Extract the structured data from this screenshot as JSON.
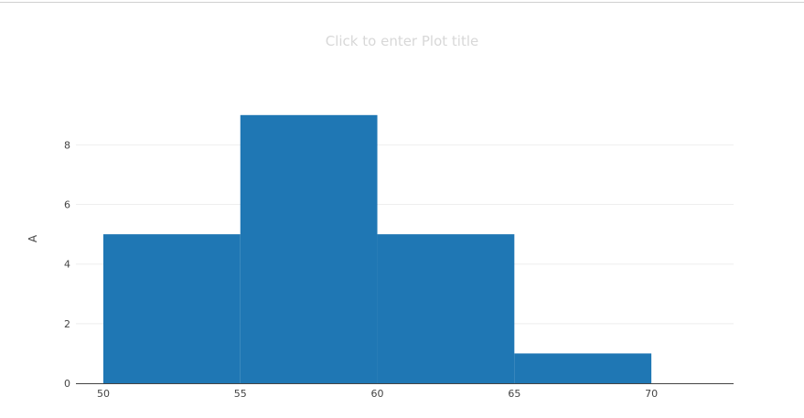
{
  "chart_data": {
    "type": "bar",
    "subtype": "histogram",
    "title": "Click to enter Plot title",
    "xlabel": "",
    "ylabel": "A",
    "bins": [
      {
        "start": 50,
        "end": 55,
        "count": 5
      },
      {
        "start": 55,
        "end": 60,
        "count": 9
      },
      {
        "start": 60,
        "end": 65,
        "count": 5
      },
      {
        "start": 65,
        "end": 70,
        "count": 1
      }
    ],
    "xlim": [
      49,
      73
    ],
    "ylim": [
      0,
      9.7
    ],
    "xticks": [
      "50",
      "55",
      "60",
      "65",
      "70"
    ],
    "yticks": [
      "0",
      "2",
      "4",
      "6",
      "8"
    ],
    "grid": true,
    "bar_color": "#1f77b4",
    "grid_color": "#eeeeee",
    "axis_color": "#444444"
  }
}
